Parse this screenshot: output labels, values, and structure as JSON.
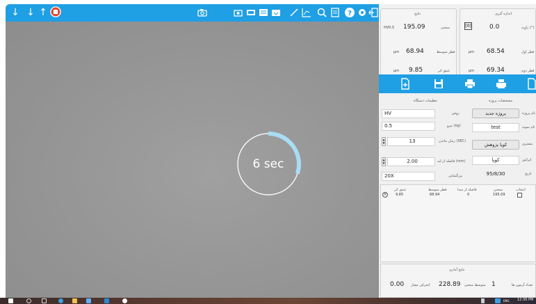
{
  "timer": {
    "text": "6 sec",
    "remaining_fraction": 0.3
  },
  "results": {
    "title": "نتایج",
    "rows": [
      {
        "value": "195.09",
        "label": "سختی",
        "unit": "HV0.5"
      },
      {
        "value": "68.94",
        "label": "قطر متوسط",
        "unit": "µm"
      },
      {
        "value": "9.85",
        "label": "عمق اثر",
        "unit": "µm"
      }
    ]
  },
  "measurement": {
    "title": "اندازه گیری",
    "rows": [
      {
        "value": "0.0",
        "label": "زاویه (°)",
        "unit": "[0]"
      },
      {
        "value": "68.54",
        "label": "قطر اول",
        "unit": "µm"
      },
      {
        "value": "69.34",
        "label": "قطر دوم",
        "unit": "µm"
      }
    ]
  },
  "device_settings": {
    "title": "تنظیمات دستگاه",
    "method": {
      "label": "روش",
      "value": "HV"
    },
    "load": {
      "label": "نیرو (kg)",
      "value": "0.5"
    },
    "dwell": {
      "label": "زمان ماندن (SEC)",
      "value": "13"
    },
    "distance": {
      "label": "فاصله از لبه (mm)",
      "value": "2.00"
    },
    "magnification": {
      "label": "بزرگنمایی",
      "value": "20X"
    }
  },
  "project_settings": {
    "title": "مشخصات پروژه",
    "project": {
      "label": "نام پروژه",
      "button": "پروژه جدید"
    },
    "sample": {
      "label": "نام نمونه",
      "value": "test"
    },
    "customer": {
      "label": "مشتری",
      "button": "کوپا پژوهش"
    },
    "operator": {
      "label": "اپراتور",
      "value": "کوپا"
    },
    "date": {
      "label": "تاریخ",
      "value": "95/8/30"
    }
  },
  "table": {
    "headers": [
      "عمق اثر",
      "قطر متوسط",
      "فاصله از مبدا",
      "سختی",
      "انتخاب"
    ],
    "rows": [
      {
        "depth": "9.85",
        "diameter": "68.94",
        "distance": "0",
        "hardness": "195.09"
      }
    ]
  },
  "stats": {
    "title": "نتایج آماری",
    "std_value": "0.00",
    "std_label": "انحراف معیار",
    "mean_value": "228.89",
    "mean_label": "متوسط سختی",
    "count_value": "1",
    "count_label": "تعداد آزمون ها"
  },
  "taskbar": {
    "time": "12:30 PM",
    "lang": "ENG"
  },
  "colors": {
    "accent": "#1f9fe4",
    "timer_arc": "#a9dcf5",
    "camera_bg": "#979797"
  }
}
